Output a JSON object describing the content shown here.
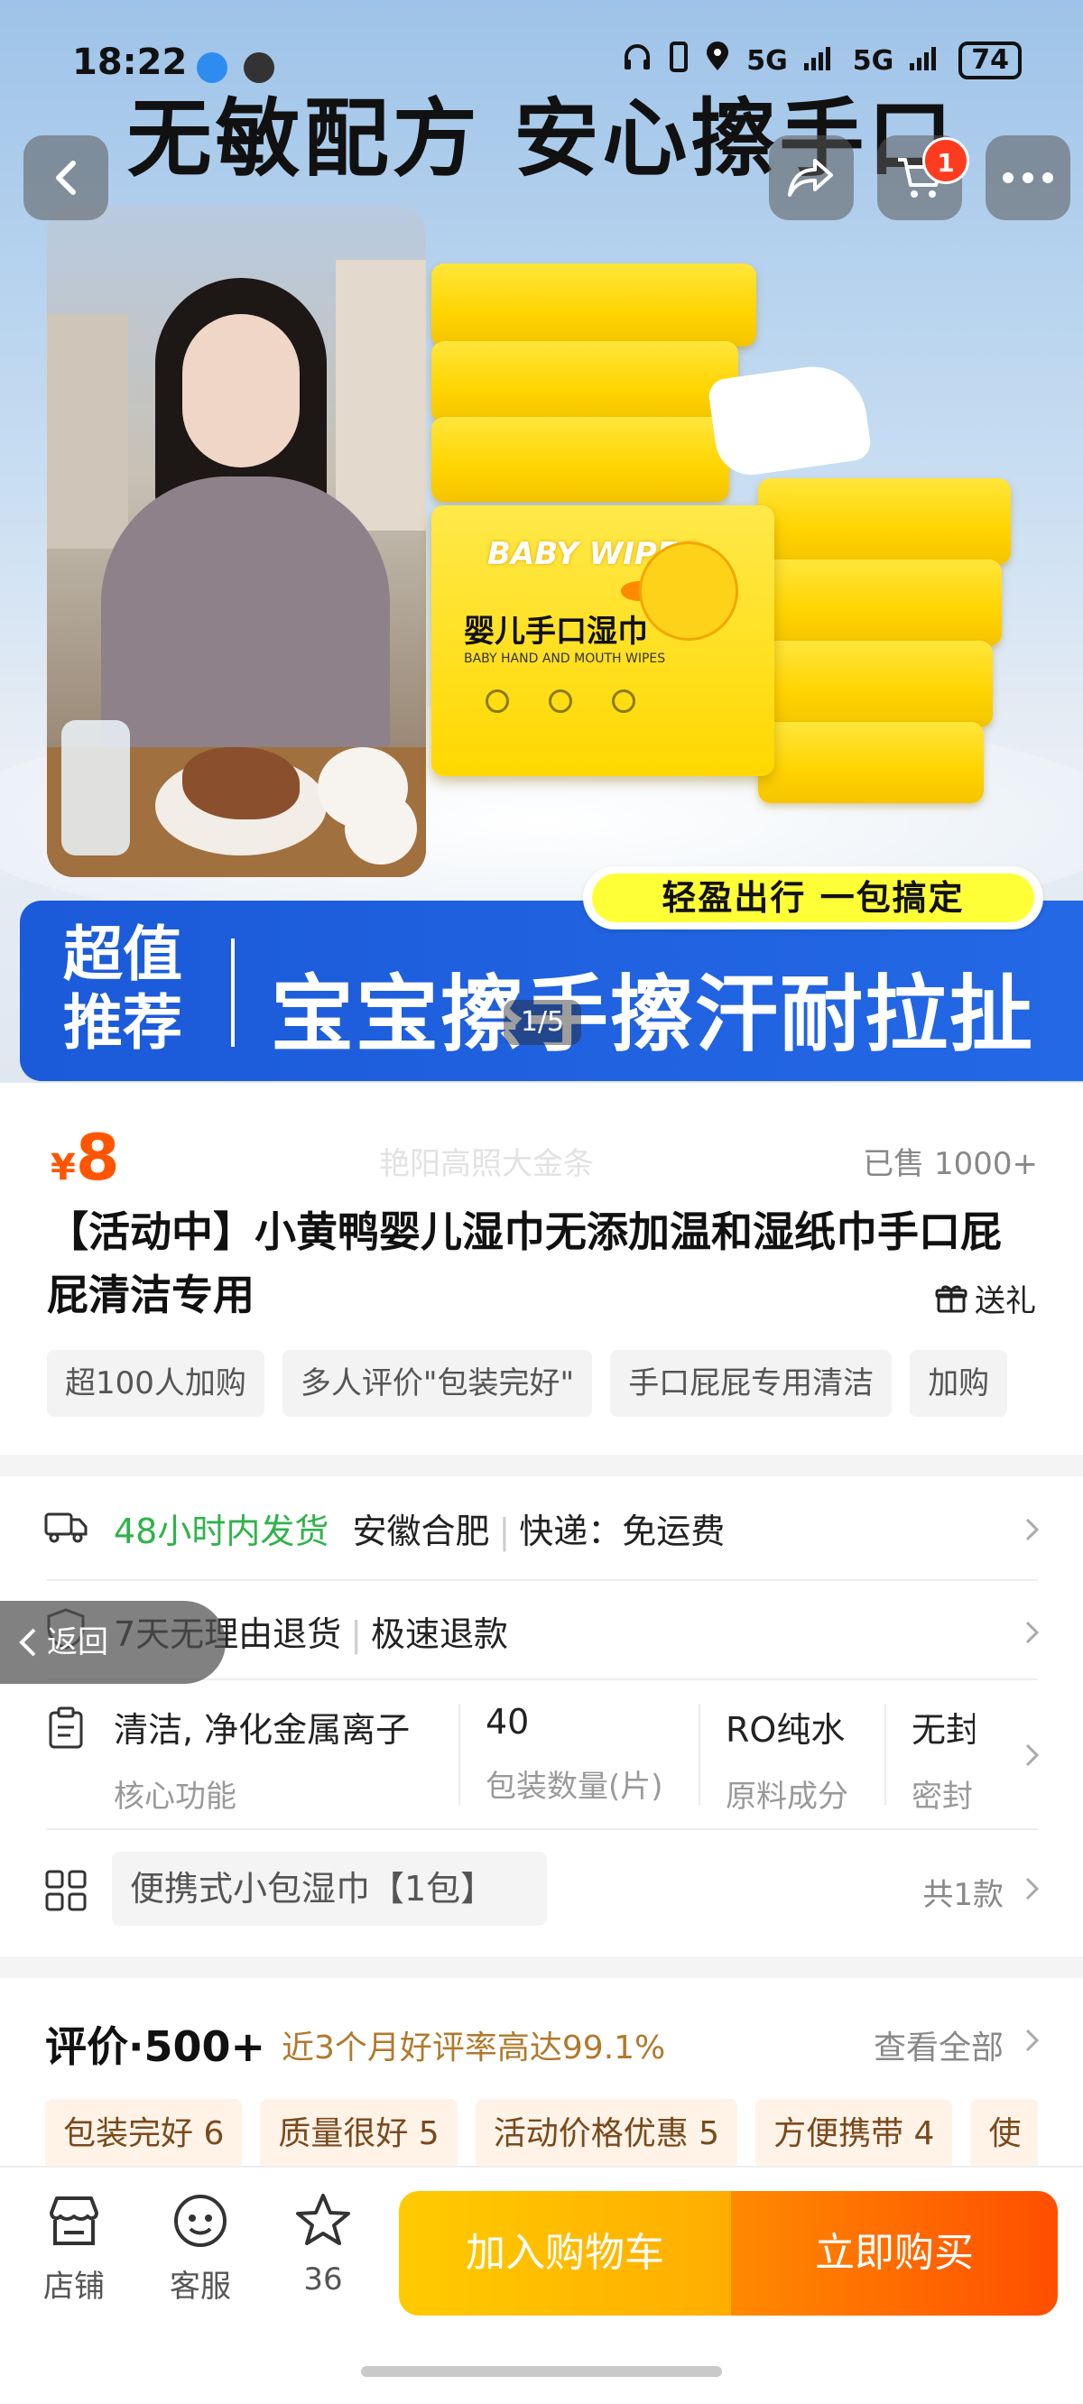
{
  "status_bar": {
    "time": "18:22",
    "signal_1": "5G",
    "signal_2": "5G",
    "battery": "74"
  },
  "hero": {
    "headline": "无敏配方 安心擦手口",
    "pack_brand_en": "BABY WIPES",
    "pack_name_cn": "婴儿手口湿巾",
    "pack_sub_en": "BABY HAND AND MOUTH WIPES",
    "tagline": "轻盈出行  一包搞定",
    "promo_left_line1": "超值",
    "promo_left_line2": "推荐",
    "promo_main": "宝宝擦手擦汗耐拉扯",
    "page_indicator": "1/5"
  },
  "nav": {
    "cart_badge": "1"
  },
  "product": {
    "price_symbol": "¥",
    "price_value": "8",
    "watermark": "艳阳高照大金条",
    "sold": "已售 1000+",
    "title": "【活动中】小黄鸭婴儿湿巾无添加温和湿纸巾手口屁屁清洁专用",
    "gift": "送礼",
    "chips": [
      "超100人加购",
      "多人评价\"包装完好\"",
      "手口屁屁专用清洁",
      "加购"
    ]
  },
  "services": {
    "shipping_highlight": "48小时内发货",
    "shipping_location": "安徽合肥",
    "shipping_express": "快递：免运费",
    "return_policy": "7天无理由退货",
    "refund": "极速退款"
  },
  "specs": [
    {
      "value": "清洁, 净化金属离子",
      "label": "核心功能"
    },
    {
      "value": "40",
      "label": "包装数量(片)"
    },
    {
      "value": "RO纯水",
      "label": "原料成分"
    },
    {
      "value": "无封",
      "label": "密封"
    }
  ],
  "variant": {
    "selected": "便携式小包湿巾【1包】",
    "count": "共1款"
  },
  "back_pill": "返回",
  "reviews": {
    "title": "评价·500+",
    "subtitle": "近3个月好评率高达99.1%",
    "view_all": "查看全部",
    "chips": [
      "包装完好 6",
      "质量很好 5",
      "活动价格优惠 5",
      "方便携带 4",
      "使"
    ]
  },
  "bottom": {
    "store_label": "店铺",
    "service_label": "客服",
    "favorite_count": "36",
    "add_to_cart": "加入购物车",
    "buy_now": "立即购买"
  },
  "colors": {
    "price": "#ff5500",
    "green": "#2fb34a",
    "promo_blue": "#1b5ad8",
    "cart_button": "#ffad00",
    "buy_button": "#ff4e00"
  }
}
